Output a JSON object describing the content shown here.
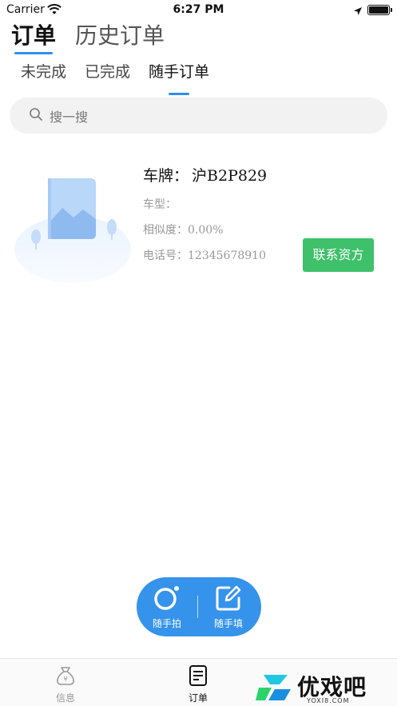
{
  "status_bar": {
    "carrier": "Carrier",
    "time": "6:27 PM",
    "battery_level": 1.0
  },
  "main_tabs": [
    {
      "label": "订单",
      "active": true
    },
    {
      "label": "历史订单",
      "active": false
    }
  ],
  "sub_tabs": [
    {
      "label": "未完成",
      "active": false
    },
    {
      "label": "已完成",
      "active": false
    },
    {
      "label": "随手订单",
      "active": true
    }
  ],
  "search": {
    "placeholder": "搜一搜",
    "icon": "search-icon"
  },
  "order": {
    "plate_label": "车牌：",
    "plate_value": "沪B2P829",
    "model_label": "车型：",
    "model_value": "",
    "similarity_label": "相似度：",
    "similarity_value": "0.00%",
    "phone_label": "电话号：",
    "phone_value": "12345678910",
    "contact_button": "联系资方",
    "image_icon": "image-placeholder-icon"
  },
  "fab": {
    "photo_label": "随手拍",
    "fill_label": "随手填",
    "photo_icon": "camera-icon",
    "fill_icon": "edit-icon"
  },
  "tab_bar": {
    "info_label": "信息",
    "order_label": "订单",
    "info_icon": "money-bag-icon",
    "order_icon": "document-icon"
  },
  "watermark": {
    "brand": "优戏吧",
    "url": "YOXI8.COM"
  },
  "colors": {
    "accent": "#2f8ef0",
    "fab": "#3593ec",
    "contact_button": "#3fc06a"
  }
}
